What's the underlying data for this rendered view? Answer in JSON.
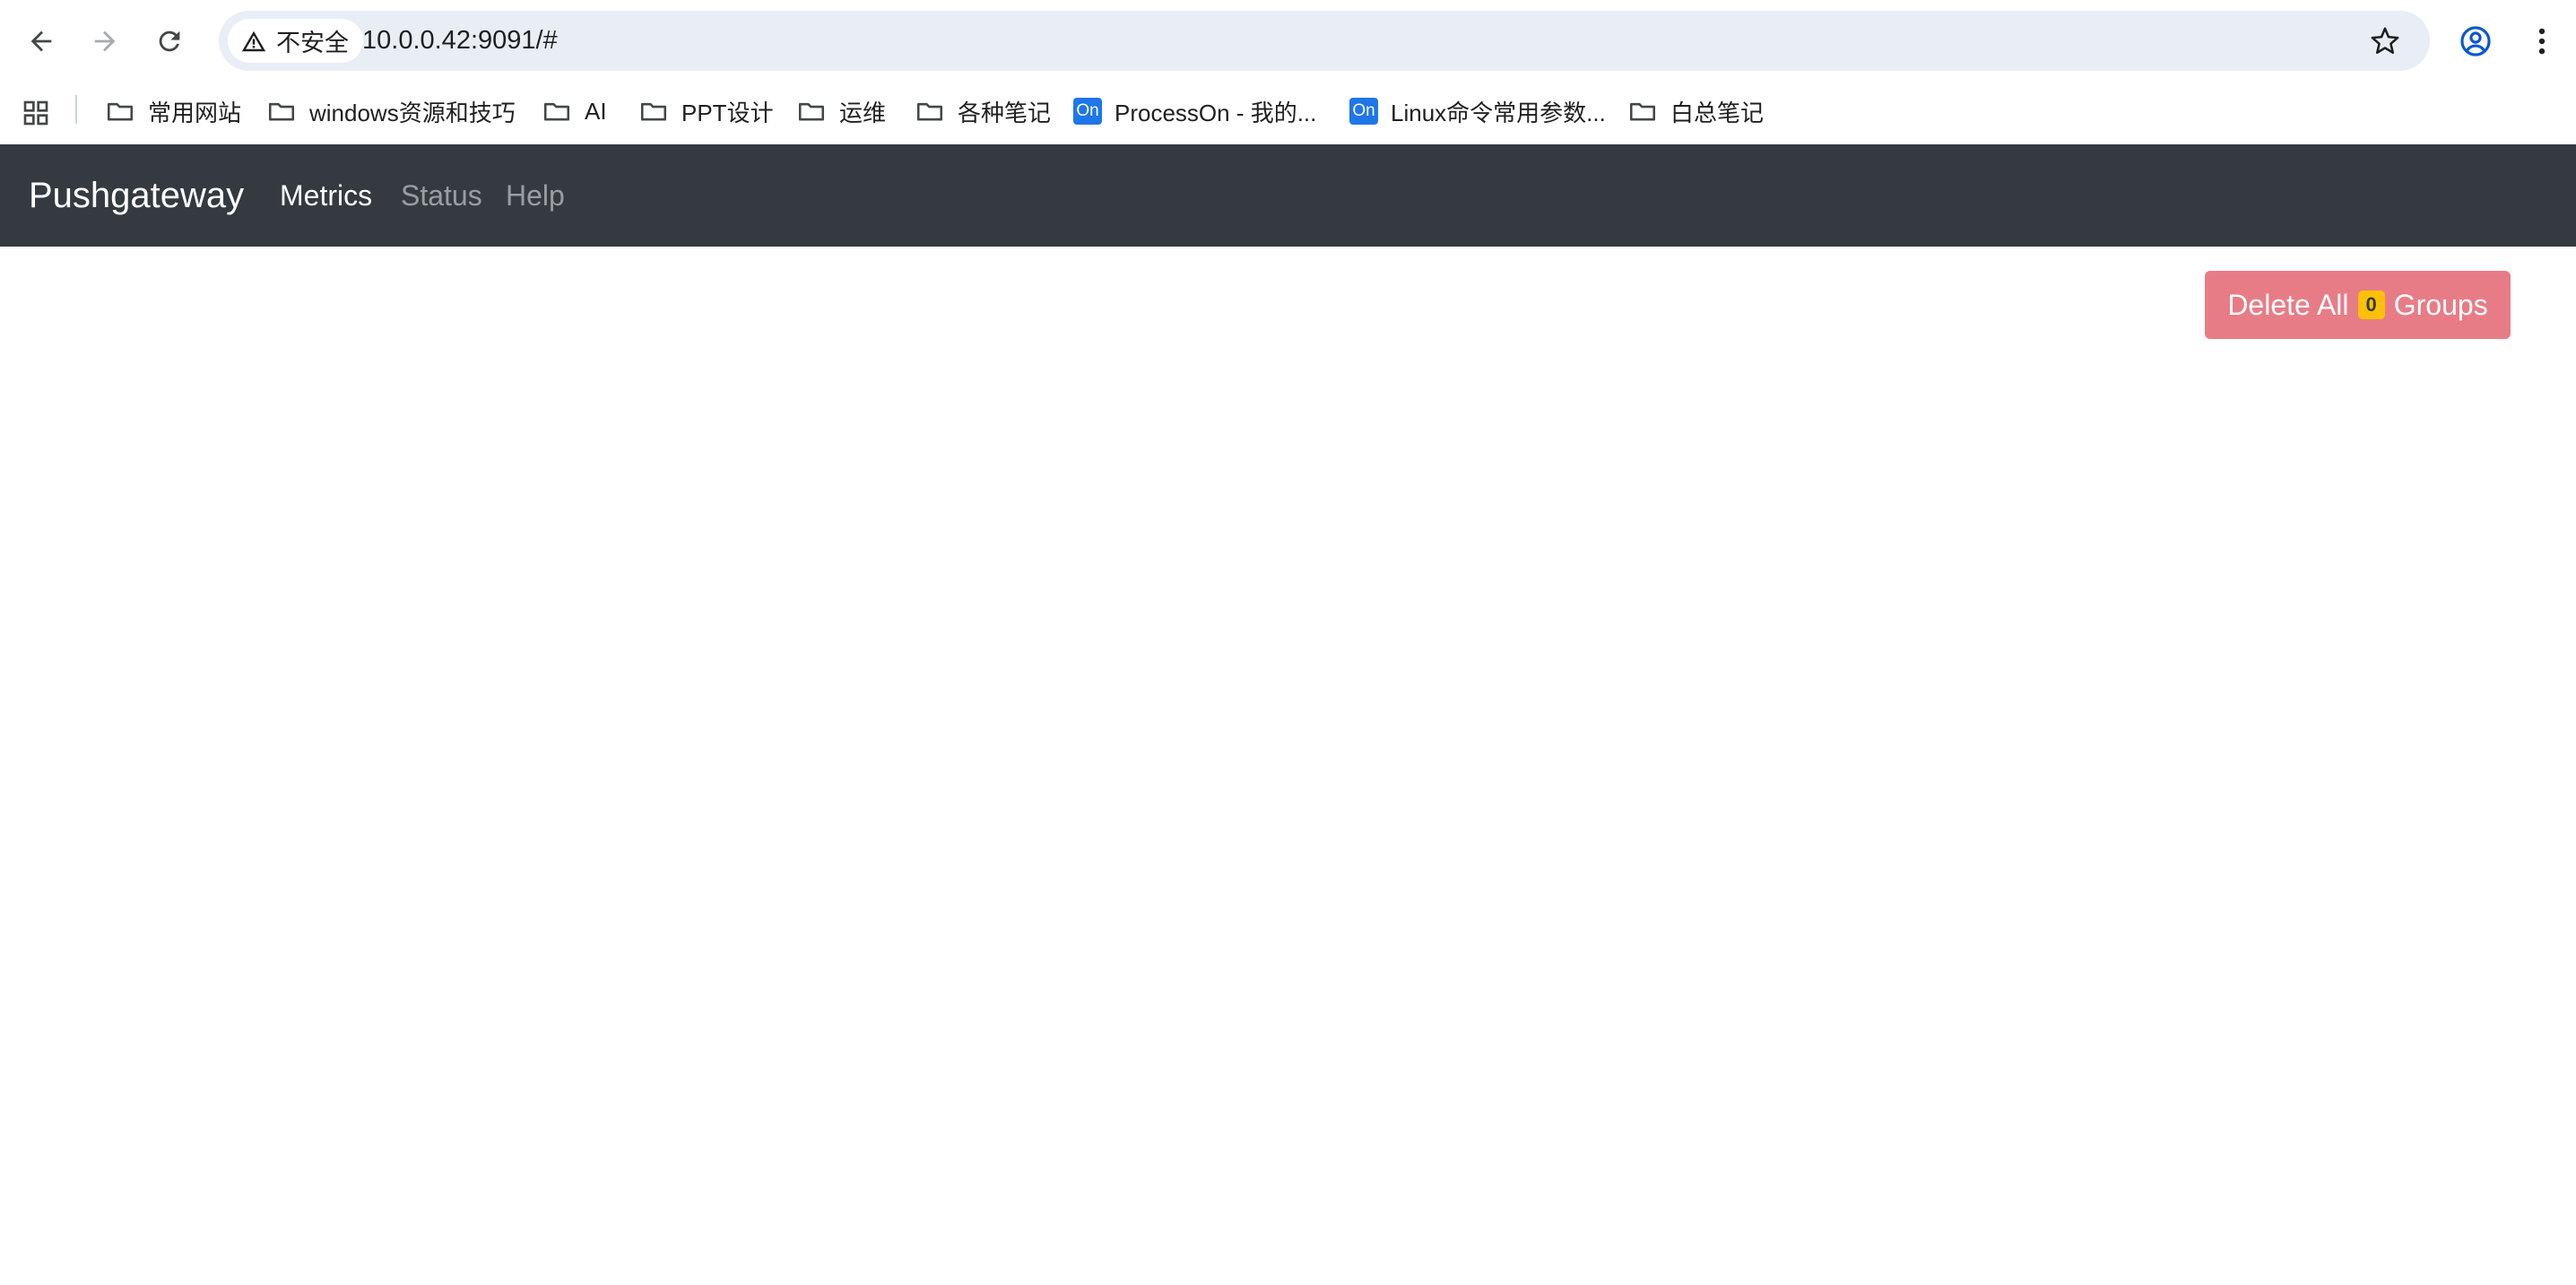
{
  "browser": {
    "security_label": "不安全",
    "url": "10.0.0.42:9091/#",
    "icons": {
      "back": "arrow-left-icon",
      "forward": "arrow-right-icon",
      "reload": "reload-icon",
      "warning": "warning-triangle-icon",
      "bookmark_star": "star-icon",
      "profile": "profile-icon",
      "menu": "kebab-menu-icon"
    }
  },
  "bookmarks": [
    {
      "label": "常用网站",
      "icon": "folder-icon"
    },
    {
      "label": "windows资源和技巧",
      "icon": "folder-icon"
    },
    {
      "label": "AI",
      "icon": "folder-icon"
    },
    {
      "label": "PPT设计",
      "icon": "folder-icon"
    },
    {
      "label": "运维",
      "icon": "folder-icon"
    },
    {
      "label": "各种笔记",
      "icon": "folder-icon"
    },
    {
      "label": "ProcessOn - 我的...",
      "icon": "processon-icon",
      "badge": "On"
    },
    {
      "label": "Linux命令常用参数...",
      "icon": "processon-icon",
      "badge": "On"
    },
    {
      "label": "白总笔记",
      "icon": "folder-icon"
    }
  ],
  "navbar": {
    "brand": "Pushgateway",
    "links": [
      {
        "label": "Metrics",
        "active": true
      },
      {
        "label": "Status",
        "active": false
      },
      {
        "label": "Help",
        "active": false
      }
    ]
  },
  "main": {
    "delete_button": {
      "prefix": "Delete All",
      "count": "0",
      "suffix": "Groups"
    }
  },
  "colors": {
    "navbar_bg": "#343a40",
    "danger_button": "#e87c86",
    "badge_warning": "#ffc107",
    "omnibox_bg": "#e9eef6",
    "processon_blue": "#1e76e8"
  }
}
